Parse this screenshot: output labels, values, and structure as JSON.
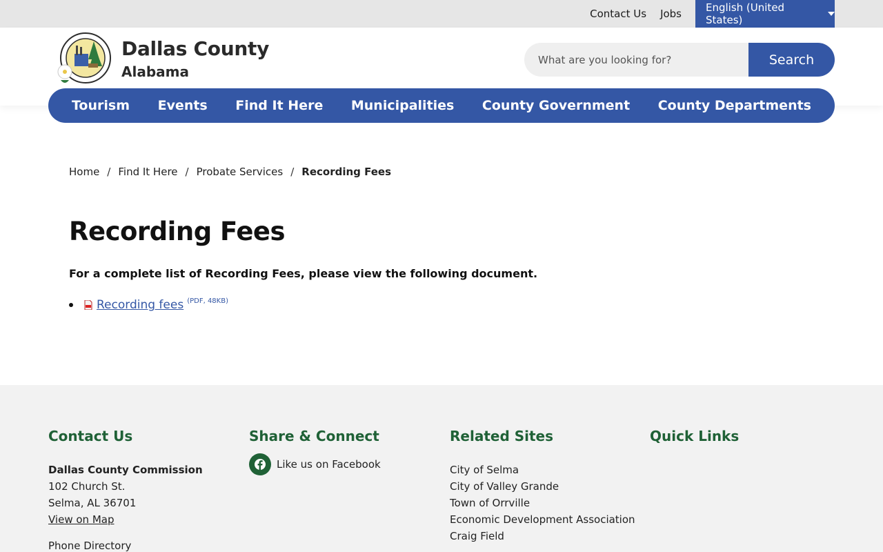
{
  "utility": {
    "contact": "Contact Us",
    "jobs": "Jobs",
    "language": "English (United States)"
  },
  "header": {
    "title": "Dallas County",
    "subtitle": "Alabama",
    "search_placeholder": "What are you looking for?",
    "search_button": "Search"
  },
  "nav": [
    "Tourism",
    "Events",
    "Find It Here",
    "Municipalities",
    "County Government",
    "County Departments"
  ],
  "breadcrumb": {
    "home": "Home",
    "find": "Find It Here",
    "probate": "Probate Services",
    "current": "Recording Fees"
  },
  "main": {
    "title": "Recording Fees",
    "intro": "For a complete list of Recording Fees, please view the following document.",
    "doc_link": "Recording fees",
    "doc_meta": "(PDF, 48KB)"
  },
  "footer": {
    "contact": {
      "heading": "Contact Us",
      "org": "Dallas County Commission",
      "address1": "102 Church St.",
      "address2": "Selma, AL 36701",
      "map": "View on Map",
      "phone": "Phone Directory"
    },
    "share": {
      "heading": "Share & Connect",
      "facebook": "Like us on Facebook"
    },
    "related": {
      "heading": "Related Sites",
      "links": [
        "City of Selma",
        "City of Valley Grande",
        "Town of Orrville",
        "Economic Development Association",
        "Craig Field"
      ]
    },
    "quick": {
      "heading": "Quick Links"
    }
  },
  "colors": {
    "brand_blue": "#3457a5",
    "footer_green": "#1f6136",
    "utility_bg": "#e6e6e6",
    "footer_bg": "#f2f2f2"
  }
}
